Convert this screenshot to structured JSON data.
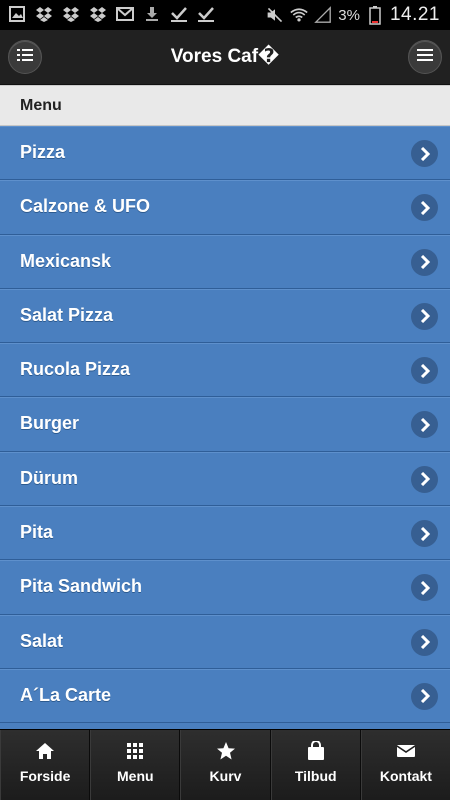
{
  "status_bar": {
    "battery_percent": "3%",
    "time": "14.21",
    "icons": [
      "gallery-icon",
      "dropbox-icon",
      "dropbox-icon",
      "dropbox-icon",
      "gmail-icon",
      "download-icon",
      "check-icon",
      "check-icon",
      "mute-icon",
      "wifi-icon",
      "signal-icon",
      "battery-icon"
    ]
  },
  "header": {
    "title": "Vores Caf�",
    "left_icon": "list-icon",
    "right_icon": "menu-icon"
  },
  "menu": {
    "divider_label": "Menu",
    "items": [
      {
        "label": "Pizza"
      },
      {
        "label": "Calzone & UFO"
      },
      {
        "label": "Mexicansk"
      },
      {
        "label": "Salat Pizza"
      },
      {
        "label": "Rucola Pizza"
      },
      {
        "label": "Burger"
      },
      {
        "label": "Dürum"
      },
      {
        "label": "Pita"
      },
      {
        "label": "Pita Sandwich"
      },
      {
        "label": "Salat"
      },
      {
        "label": "A´La Carte"
      }
    ]
  },
  "footer": {
    "tabs": [
      {
        "label": "Forside",
        "icon": "home-icon"
      },
      {
        "label": "Menu",
        "icon": "grid-icon"
      },
      {
        "label": "Kurv",
        "icon": "star-icon"
      },
      {
        "label": "Tilbud",
        "icon": "bag-icon"
      },
      {
        "label": "Kontakt",
        "icon": "mail-icon"
      }
    ]
  },
  "colors": {
    "list_bg": "#4a7fbf",
    "header_bg": "#212121",
    "divider_bg": "#e9e9e9"
  }
}
